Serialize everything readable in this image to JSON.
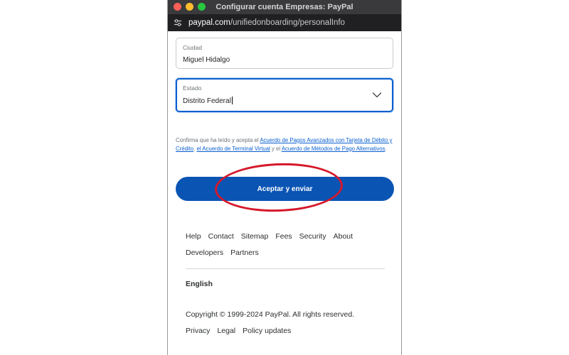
{
  "window": {
    "title": "Configurar cuenta Empresas: PayPal"
  },
  "urlbar": {
    "domain": "paypal.com",
    "path": "/unifiedonboarding/personalInfo"
  },
  "form": {
    "city": {
      "label": "Ciudad",
      "value": "Miguel Hidalgo"
    },
    "state": {
      "label": "Estado",
      "value": "Distrito Federal"
    },
    "terms": {
      "prefix": "Confirma que ha leído y acepta el ",
      "link1": "Acuerdo de Pagos Avanzados con Tarjeta de Débito y Crédito",
      "sep1": ", ",
      "link2": "el Acuerdo de Terminal Virtual",
      "sep2": " y el ",
      "link3": "Acuerdo de Métodos de Pago Alternativos",
      "suffix": "."
    },
    "submit_label": "Aceptar y enviar"
  },
  "footer": {
    "links_row1": [
      "Help",
      "Contact",
      "Sitemap",
      "Fees",
      "Security",
      "About"
    ],
    "links_row2": [
      "Developers",
      "Partners"
    ],
    "language": "English",
    "copyright": "Copyright © 1999-2024 PayPal. All rights reserved.",
    "legal_links": [
      "Privacy",
      "Legal",
      "Policy updates"
    ]
  },
  "colors": {
    "accent": "#0a54b4",
    "link": "#0a5fd0",
    "annotation": "#d6182a"
  }
}
